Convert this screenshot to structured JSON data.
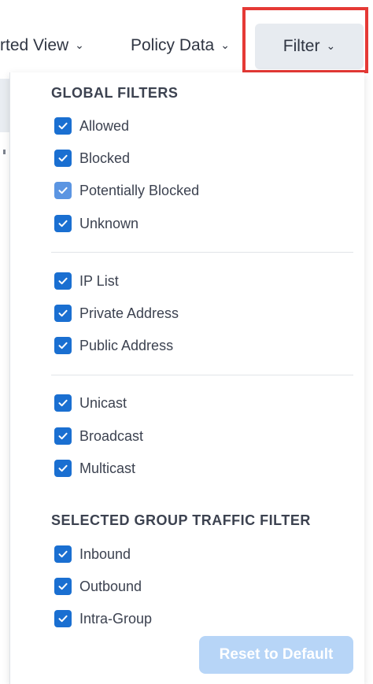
{
  "toolbar": {
    "view_label": "rted View",
    "policy_label": "Policy Data",
    "filter_label": "Filter",
    "chevron": "chevron-down-icon"
  },
  "filter_panel": {
    "global_title": "GLOBAL FILTERS",
    "group1": [
      {
        "label": "Allowed",
        "checked": true
      },
      {
        "label": "Blocked",
        "checked": true
      },
      {
        "label": "Potentially Blocked",
        "checked": true
      },
      {
        "label": "Unknown",
        "checked": true
      }
    ],
    "group2": [
      {
        "label": "IP List",
        "checked": true
      },
      {
        "label": "Private Address",
        "checked": true
      },
      {
        "label": "Public Address",
        "checked": true
      }
    ],
    "group3": [
      {
        "label": "Unicast",
        "checked": true
      },
      {
        "label": "Broadcast",
        "checked": true
      },
      {
        "label": "Multicast",
        "checked": true
      }
    ],
    "traffic_title": "SELECTED GROUP TRAFFIC FILTER",
    "traffic": [
      {
        "label": "Inbound",
        "checked": true
      },
      {
        "label": "Outbound",
        "checked": true
      },
      {
        "label": "Intra-Group",
        "checked": true
      }
    ],
    "reset_label": "Reset to Default"
  },
  "colors": {
    "accent": "#1a6fd1",
    "reset_disabled": "#b7d5f7",
    "highlight": "#e53935"
  }
}
